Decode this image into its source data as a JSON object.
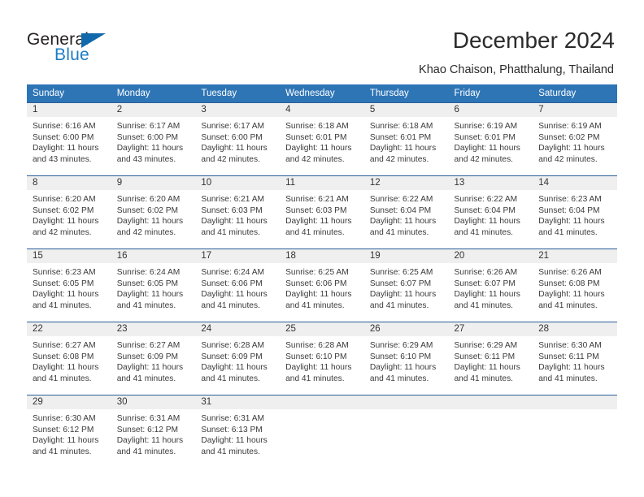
{
  "brand": {
    "name_part1": "General",
    "name_part2": "Blue",
    "triangle_color": "#1168ab",
    "blue_color": "#1d7cc4"
  },
  "header": {
    "title": "December 2024",
    "subtitle": "Khao Chaison, Phatthalung, Thailand",
    "header_bg": "#2e75b6",
    "separator_color": "#2a6099",
    "daybar_bg": "#efefef"
  },
  "weekdays": [
    "Sunday",
    "Monday",
    "Tuesday",
    "Wednesday",
    "Thursday",
    "Friday",
    "Saturday"
  ],
  "weeks": [
    [
      {
        "day": "1",
        "sunrise": "Sunrise: 6:16 AM",
        "sunset": "Sunset: 6:00 PM",
        "daylight1": "Daylight: 11 hours",
        "daylight2": "and 43 minutes."
      },
      {
        "day": "2",
        "sunrise": "Sunrise: 6:17 AM",
        "sunset": "Sunset: 6:00 PM",
        "daylight1": "Daylight: 11 hours",
        "daylight2": "and 43 minutes."
      },
      {
        "day": "3",
        "sunrise": "Sunrise: 6:17 AM",
        "sunset": "Sunset: 6:00 PM",
        "daylight1": "Daylight: 11 hours",
        "daylight2": "and 42 minutes."
      },
      {
        "day": "4",
        "sunrise": "Sunrise: 6:18 AM",
        "sunset": "Sunset: 6:01 PM",
        "daylight1": "Daylight: 11 hours",
        "daylight2": "and 42 minutes."
      },
      {
        "day": "5",
        "sunrise": "Sunrise: 6:18 AM",
        "sunset": "Sunset: 6:01 PM",
        "daylight1": "Daylight: 11 hours",
        "daylight2": "and 42 minutes."
      },
      {
        "day": "6",
        "sunrise": "Sunrise: 6:19 AM",
        "sunset": "Sunset: 6:01 PM",
        "daylight1": "Daylight: 11 hours",
        "daylight2": "and 42 minutes."
      },
      {
        "day": "7",
        "sunrise": "Sunrise: 6:19 AM",
        "sunset": "Sunset: 6:02 PM",
        "daylight1": "Daylight: 11 hours",
        "daylight2": "and 42 minutes."
      }
    ],
    [
      {
        "day": "8",
        "sunrise": "Sunrise: 6:20 AM",
        "sunset": "Sunset: 6:02 PM",
        "daylight1": "Daylight: 11 hours",
        "daylight2": "and 42 minutes."
      },
      {
        "day": "9",
        "sunrise": "Sunrise: 6:20 AM",
        "sunset": "Sunset: 6:02 PM",
        "daylight1": "Daylight: 11 hours",
        "daylight2": "and 42 minutes."
      },
      {
        "day": "10",
        "sunrise": "Sunrise: 6:21 AM",
        "sunset": "Sunset: 6:03 PM",
        "daylight1": "Daylight: 11 hours",
        "daylight2": "and 41 minutes."
      },
      {
        "day": "11",
        "sunrise": "Sunrise: 6:21 AM",
        "sunset": "Sunset: 6:03 PM",
        "daylight1": "Daylight: 11 hours",
        "daylight2": "and 41 minutes."
      },
      {
        "day": "12",
        "sunrise": "Sunrise: 6:22 AM",
        "sunset": "Sunset: 6:04 PM",
        "daylight1": "Daylight: 11 hours",
        "daylight2": "and 41 minutes."
      },
      {
        "day": "13",
        "sunrise": "Sunrise: 6:22 AM",
        "sunset": "Sunset: 6:04 PM",
        "daylight1": "Daylight: 11 hours",
        "daylight2": "and 41 minutes."
      },
      {
        "day": "14",
        "sunrise": "Sunrise: 6:23 AM",
        "sunset": "Sunset: 6:04 PM",
        "daylight1": "Daylight: 11 hours",
        "daylight2": "and 41 minutes."
      }
    ],
    [
      {
        "day": "15",
        "sunrise": "Sunrise: 6:23 AM",
        "sunset": "Sunset: 6:05 PM",
        "daylight1": "Daylight: 11 hours",
        "daylight2": "and 41 minutes."
      },
      {
        "day": "16",
        "sunrise": "Sunrise: 6:24 AM",
        "sunset": "Sunset: 6:05 PM",
        "daylight1": "Daylight: 11 hours",
        "daylight2": "and 41 minutes."
      },
      {
        "day": "17",
        "sunrise": "Sunrise: 6:24 AM",
        "sunset": "Sunset: 6:06 PM",
        "daylight1": "Daylight: 11 hours",
        "daylight2": "and 41 minutes."
      },
      {
        "day": "18",
        "sunrise": "Sunrise: 6:25 AM",
        "sunset": "Sunset: 6:06 PM",
        "daylight1": "Daylight: 11 hours",
        "daylight2": "and 41 minutes."
      },
      {
        "day": "19",
        "sunrise": "Sunrise: 6:25 AM",
        "sunset": "Sunset: 6:07 PM",
        "daylight1": "Daylight: 11 hours",
        "daylight2": "and 41 minutes."
      },
      {
        "day": "20",
        "sunrise": "Sunrise: 6:26 AM",
        "sunset": "Sunset: 6:07 PM",
        "daylight1": "Daylight: 11 hours",
        "daylight2": "and 41 minutes."
      },
      {
        "day": "21",
        "sunrise": "Sunrise: 6:26 AM",
        "sunset": "Sunset: 6:08 PM",
        "daylight1": "Daylight: 11 hours",
        "daylight2": "and 41 minutes."
      }
    ],
    [
      {
        "day": "22",
        "sunrise": "Sunrise: 6:27 AM",
        "sunset": "Sunset: 6:08 PM",
        "daylight1": "Daylight: 11 hours",
        "daylight2": "and 41 minutes."
      },
      {
        "day": "23",
        "sunrise": "Sunrise: 6:27 AM",
        "sunset": "Sunset: 6:09 PM",
        "daylight1": "Daylight: 11 hours",
        "daylight2": "and 41 minutes."
      },
      {
        "day": "24",
        "sunrise": "Sunrise: 6:28 AM",
        "sunset": "Sunset: 6:09 PM",
        "daylight1": "Daylight: 11 hours",
        "daylight2": "and 41 minutes."
      },
      {
        "day": "25",
        "sunrise": "Sunrise: 6:28 AM",
        "sunset": "Sunset: 6:10 PM",
        "daylight1": "Daylight: 11 hours",
        "daylight2": "and 41 minutes."
      },
      {
        "day": "26",
        "sunrise": "Sunrise: 6:29 AM",
        "sunset": "Sunset: 6:10 PM",
        "daylight1": "Daylight: 11 hours",
        "daylight2": "and 41 minutes."
      },
      {
        "day": "27",
        "sunrise": "Sunrise: 6:29 AM",
        "sunset": "Sunset: 6:11 PM",
        "daylight1": "Daylight: 11 hours",
        "daylight2": "and 41 minutes."
      },
      {
        "day": "28",
        "sunrise": "Sunrise: 6:30 AM",
        "sunset": "Sunset: 6:11 PM",
        "daylight1": "Daylight: 11 hours",
        "daylight2": "and 41 minutes."
      }
    ],
    [
      {
        "day": "29",
        "sunrise": "Sunrise: 6:30 AM",
        "sunset": "Sunset: 6:12 PM",
        "daylight1": "Daylight: 11 hours",
        "daylight2": "and 41 minutes."
      },
      {
        "day": "30",
        "sunrise": "Sunrise: 6:31 AM",
        "sunset": "Sunset: 6:12 PM",
        "daylight1": "Daylight: 11 hours",
        "daylight2": "and 41 minutes."
      },
      {
        "day": "31",
        "sunrise": "Sunrise: 6:31 AM",
        "sunset": "Sunset: 6:13 PM",
        "daylight1": "Daylight: 11 hours",
        "daylight2": "and 41 minutes."
      },
      {
        "day": "",
        "sunrise": "",
        "sunset": "",
        "daylight1": "",
        "daylight2": ""
      },
      {
        "day": "",
        "sunrise": "",
        "sunset": "",
        "daylight1": "",
        "daylight2": ""
      },
      {
        "day": "",
        "sunrise": "",
        "sunset": "",
        "daylight1": "",
        "daylight2": ""
      },
      {
        "day": "",
        "sunrise": "",
        "sunset": "",
        "daylight1": "",
        "daylight2": ""
      }
    ]
  ]
}
